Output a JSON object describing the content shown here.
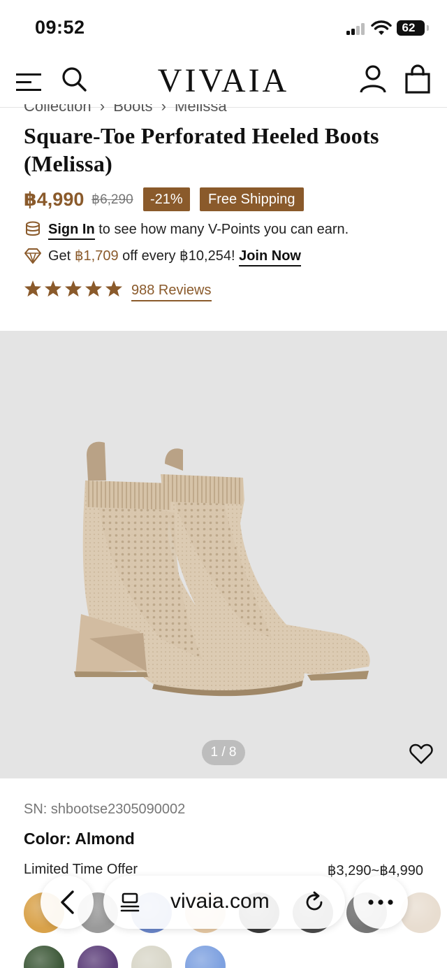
{
  "status_bar": {
    "time": "09:52",
    "battery": "62"
  },
  "header": {
    "logo": "VIVAIA"
  },
  "breadcrumb": [
    "Collection",
    "Boots",
    "Melissa"
  ],
  "product": {
    "title": "Square-Toe Perforated Heeled Boots (Melissa)",
    "price": "฿4,990",
    "old_price": "฿6,290",
    "discount": "-21%",
    "shipping_badge": "Free Shipping",
    "points": {
      "link": "Sign In",
      "text": "to see how many V-Points you can earn."
    },
    "join": {
      "prefix": "Get",
      "amount": "฿1,709",
      "middle": "off every ฿10,254!",
      "link": "Join Now"
    },
    "rating": {
      "stars": 5,
      "reviews": "988 Reviews"
    },
    "gallery": {
      "pager": "1 / 8"
    },
    "sn": "SN: shbootse2305090002",
    "color": "Color: Almond",
    "offer": {
      "label": "Limited Time Offer",
      "range": "฿3,290~฿4,990"
    },
    "swatch_colors": [
      "#d9a24a",
      "#9a9a9a",
      "#6a86c9",
      "#e7c9a4",
      "#3a3a3a",
      "#4a4a4a",
      "#777777",
      "#e8ddd0",
      "#3f5a3a",
      "#5d3f7a",
      "#d8d6c8",
      "#7ea1e0"
    ]
  },
  "browser": {
    "url": "vivaia.com"
  },
  "colors": {
    "accent": "#8a5a2b",
    "gallery_bg": "#e4e4e4"
  }
}
